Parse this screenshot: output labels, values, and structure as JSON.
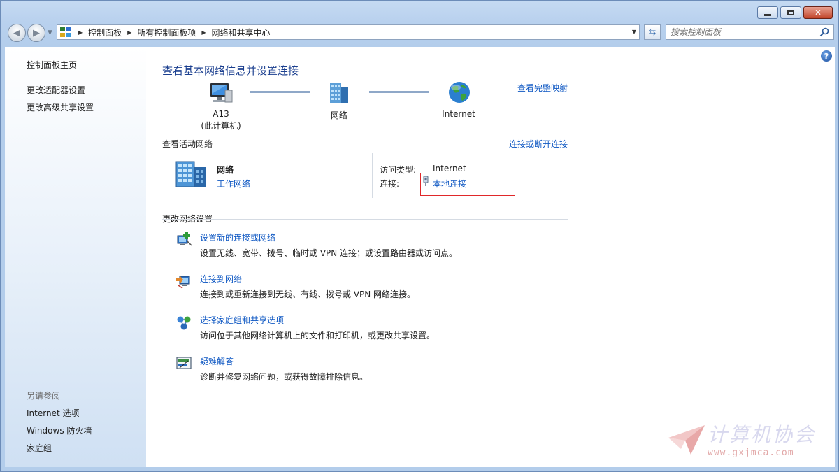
{
  "address_bar": {
    "crumbs": [
      "控制面板",
      "所有控制面板项",
      "网络和共享中心"
    ]
  },
  "search": {
    "placeholder": "搜索控制面板"
  },
  "sidebar": {
    "items": [
      {
        "label": "控制面板主页"
      },
      {
        "label": "更改适配器设置"
      },
      {
        "label": "更改高级共享设置"
      }
    ],
    "see_also_heading": "另请参阅",
    "see_also": [
      {
        "label": "Internet 选项"
      },
      {
        "label": "Windows 防火墙"
      },
      {
        "label": "家庭组"
      }
    ]
  },
  "main": {
    "title": "查看基本网络信息并设置连接",
    "full_map_link": "查看完整映射",
    "nodes": {
      "computer_name": "A13",
      "computer_sub": "(此计算机)",
      "network": "网络",
      "internet": "Internet"
    },
    "active_networks": {
      "heading": "查看活动网络",
      "connect_link": "连接或断开连接",
      "network_name": "网络",
      "network_type": "工作网络",
      "access_type_label": "访问类型:",
      "access_type_value": "Internet",
      "connections_label": "连接:",
      "connection_value": "本地连接"
    },
    "change_settings": {
      "heading": "更改网络设置",
      "tasks": [
        {
          "title": "设置新的连接或网络",
          "desc": "设置无线、宽带、拨号、临时或 VPN 连接；或设置路由器或访问点。",
          "icon": "new-connection-icon"
        },
        {
          "title": "连接到网络",
          "desc": "连接到或重新连接到无线、有线、拨号或 VPN 网络连接。",
          "icon": "connect-network-icon"
        },
        {
          "title": "选择家庭组和共享选项",
          "desc": "访问位于其他网络计算机上的文件和打印机，或更改共享设置。",
          "icon": "homegroup-icon"
        },
        {
          "title": "疑难解答",
          "desc": "诊断并修复网络问题，或获得故障排除信息。",
          "icon": "troubleshoot-icon"
        }
      ]
    }
  },
  "watermark": {
    "text": "计算机协会",
    "url": "www.gxjmca.com"
  }
}
